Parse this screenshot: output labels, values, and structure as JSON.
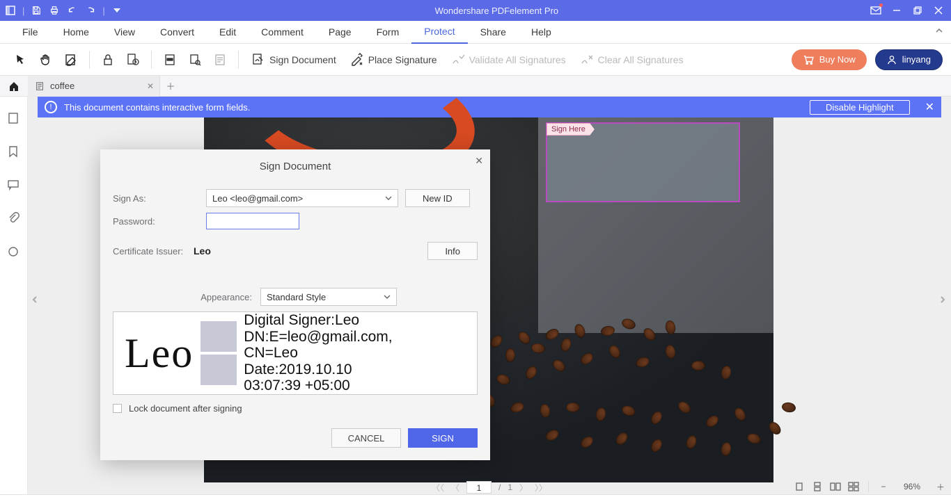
{
  "app": {
    "title": "Wondershare PDFelement Pro"
  },
  "menu": {
    "items": [
      "File",
      "Home",
      "View",
      "Convert",
      "Edit",
      "Comment",
      "Page",
      "Form",
      "Protect",
      "Share",
      "Help"
    ],
    "active": "Protect"
  },
  "ribbon": {
    "sign_document": "Sign Document",
    "place_signature": "Place Signature",
    "validate_all": "Validate All Signatures",
    "clear_all": "Clear All Signatures",
    "buy_now": "Buy Now",
    "user": "linyang"
  },
  "tabs": {
    "current": "coffee"
  },
  "infobar": {
    "message": "This document contains interactive form fields.",
    "disable": "Disable Highlight"
  },
  "sign_field": {
    "tag": "Sign Here"
  },
  "dialog": {
    "title": "Sign Document",
    "labels": {
      "sign_as": "Sign As:",
      "password": "Password:",
      "cert_issuer": "Certificate Issuer:",
      "appearance": "Appearance:"
    },
    "sign_as_value": "Leo <leo@gmail.com>",
    "new_id": "New ID",
    "cert_issuer_value": "Leo",
    "info": "Info",
    "appearance_value": "Standard Style",
    "preview": {
      "name": "Leo",
      "line1": "Digital Signer:Leo",
      "line2": "DN:E=leo@gmail.com,",
      "line3": "CN=Leo",
      "line4": "Date:2019.10.10",
      "line5": " 03:07:39 +05:00"
    },
    "lock": "Lock document after signing",
    "cancel": "CANCEL",
    "sign": "SIGN"
  },
  "pager": {
    "page": "1",
    "total": "1"
  },
  "zoom": {
    "value": "96%"
  }
}
